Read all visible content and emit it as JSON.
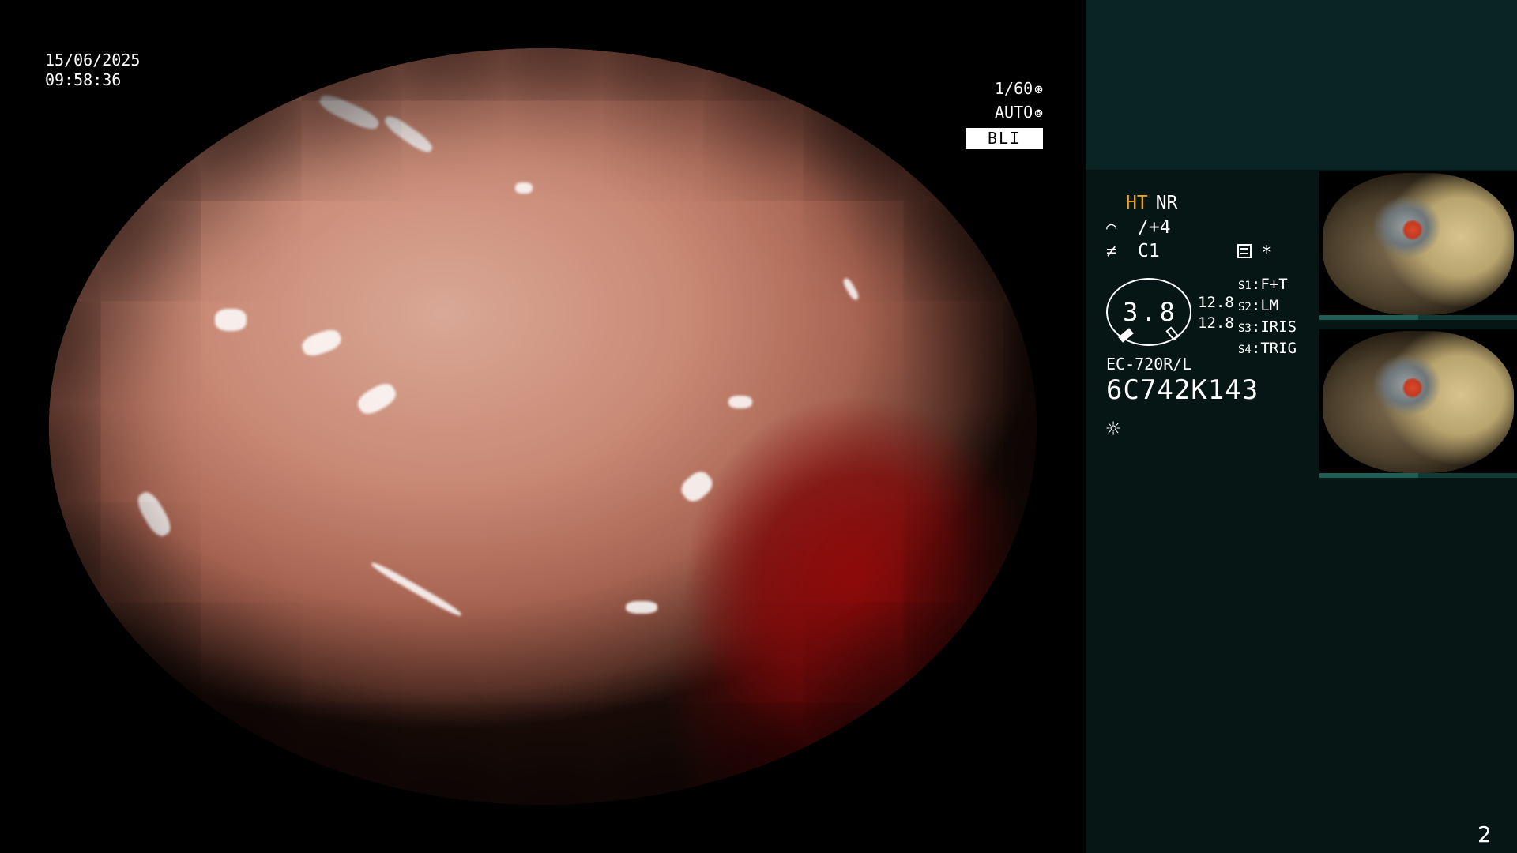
{
  "overlay": {
    "date": "15/06/2025",
    "time": "09:58:36",
    "shutter": "1/60",
    "shutter_icon": "aperture-icon",
    "exposure": "AUTO",
    "exposure_icon": "iris-icon",
    "mode": "BLI"
  },
  "panel": {
    "ht_label": "HT",
    "nr_label": "NR",
    "enhance_icon": "enhance-icon",
    "enhance_value": "/+4",
    "color_icon": "color-icon",
    "color_value": "C1",
    "grid_icon": "menu-grid-icon",
    "asterisk": "*",
    "zoom_value": "3.8",
    "gain_values": [
      "12.8",
      "12.8"
    ],
    "switches": [
      {
        "key": "S1",
        "value": "F+T"
      },
      {
        "key": "S2",
        "value": "LM"
      },
      {
        "key": "S3",
        "value": "IRIS"
      },
      {
        "key": "S4",
        "value": "TRIG"
      }
    ],
    "scope_model": "EC-720R/L",
    "serial_number": "6C742K143",
    "light_icon": "light-source-icon"
  },
  "thumbnails": [
    {
      "name": "capture-1"
    },
    {
      "name": "capture-2"
    }
  ],
  "page_number": "2",
  "colors": {
    "background": "#000000",
    "panel": "#051614",
    "panel_top": "#0a2424",
    "accent": "#f0a818",
    "text": "#ffffff"
  }
}
